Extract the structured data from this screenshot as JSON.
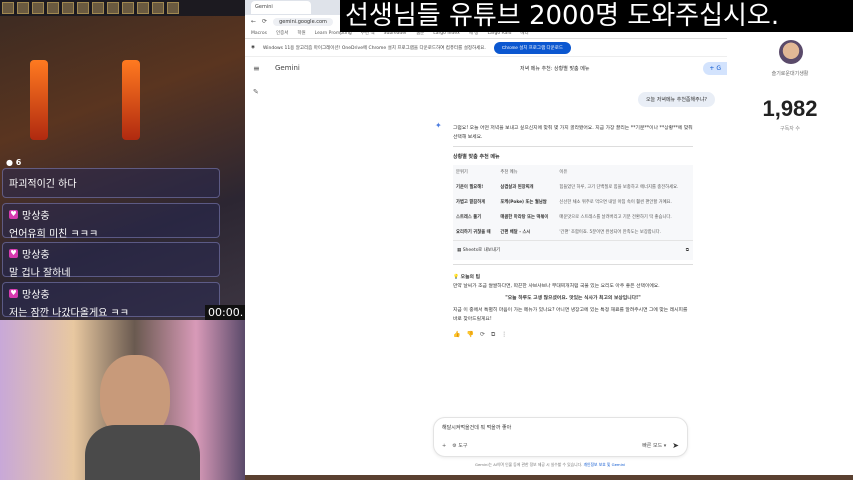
{
  "banner": "선생님들 유튜브 2000명 도와주십시오.",
  "stream": {
    "viewers": "6",
    "timer": "00:00.",
    "chat": [
      {
        "user": "",
        "msg": "파괴적이긴 하다"
      },
      {
        "user": "망상충",
        "msg": "언어유희 미친 ㅋㅋㅋ"
      },
      {
        "user": "망상충",
        "msg": "말 겁나 잘하네"
      },
      {
        "user": "망상충",
        "msg": "저는 잠깐 나갔다올게요 ㅋㅋ"
      }
    ]
  },
  "browser": {
    "tab": "Gemini",
    "url": "gemini.google.com",
    "bookmarks": [
      "Macros",
      "인증서",
      "학원",
      "Learn Prompting",
      "추천 책",
      "Subreader",
      "웹툰",
      "Largo Index",
      "세 정",
      "Largo Raid",
      "메디"
    ],
    "infobar": "Windows 11용 알고리즘 마이그레이션! OneDrive에 Chrome 설치 프로그램을 다운로드하여 컴퓨터를 설정하세요.",
    "infobar_button": "Chrome 설치 프로그램 다운로드"
  },
  "gemini": {
    "brand": "Gemini",
    "chat_title": "저녁 메뉴 추천: 상황별 맞춤 메뉴",
    "new_chat": "+ G",
    "user_question": "오늘 저녁메뉴 추천좀해주냐?",
    "intro": "그럼요! 오늘 어떤 저녁을 보내고 싶으신지에 맞춰 몇 가지 골라봤어요. 지금 가장 끌리는 **기분**이나 **상황**에 맞춰 선택해 보세요.",
    "table_title": "상황별 맞춤 추천 메뉴",
    "table_headers": [
      "분위기",
      "추천 메뉴",
      "이유"
    ],
    "table_rows": [
      [
        "기운이 필요해!",
        "삼겹살과 된장찌개",
        "힘들었던 하루, 고기 단백질로 힘을 보충하고 에너지를 충전하세요."
      ],
      [
        "가볍고 깔끔하게",
        "포케(Poke) 또는 월남쌈",
        "신선한 채소 위주로 먹으면 내일 아침 속이 훨씬 편안할 거예요."
      ],
      [
        "스트레스 풀기",
        "매콤한 마라탕 또는 떡볶이",
        "매운맛으로 스트레스를 날려버리고 기분 전환하기 딱 좋습니다."
      ],
      [
        "요리하기 귀찮을 때",
        "간편 배달 - 스시",
        "'간편' 조합이죠. 5분이면 완성되어 만족도는 보장합니다."
      ]
    ],
    "sheets_export": "Sheets로 내보내기",
    "tip_title": "오늘의 팁",
    "tip": "만약 날씨가 조금 쌀쌀하다면, 따끈한 샤브샤브나 부대찌개처럼 국물 있는 요리도 아주 좋은 선택이에요.",
    "quote": "\"오늘 하루도 고생 많으셨어요. 맛있는 식사가 최고의 보상입니다!\"",
    "followup": "지금 이 중에서 특별히 마음이 가는 메뉴가 있나요? 아니면 냉장고에 있는 특정 재료를 알려주시면 그에 맞는 레시피를 바로 찾아드릴게요!",
    "input_value": "해달시켜먹을건데 뭐 먹을까 좋아",
    "tools": "도구",
    "mode": "빠른 모드",
    "footer": "Gemini는 AI이며 인물 등에 관한 정보 제공 시 실수할 수 있습니다.",
    "footer_link": "개인정보 보호 및 Gemini"
  },
  "channel": {
    "name": "슬기로운대기생활",
    "subscribers": "1,982",
    "subscribers_label": "구독자 수"
  }
}
